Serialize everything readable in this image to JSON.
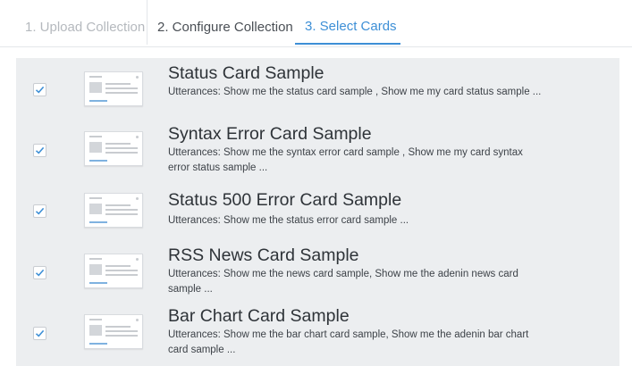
{
  "tabs": [
    {
      "label": "1. Upload Collection"
    },
    {
      "label": "2. Configure Collection"
    },
    {
      "label": "3. Select Cards"
    }
  ],
  "cards": [
    {
      "title": "Status Card Sample",
      "utterances": "Utterances:  Show me the status card sample ,  Show me my card status sample ...",
      "checked": true
    },
    {
      "title": "Syntax Error Card Sample",
      "utterances": "Utterances:  Show me the syntax error card sample ,  Show me my card syntax error status sample  ...",
      "checked": true
    },
    {
      "title": "Status 500 Error Card Sample",
      "utterances": "Utterances:  Show me the status error card sample  ...",
      "checked": true
    },
    {
      "title": "RSS News Card Sample",
      "utterances": "Utterances:  Show me the news card sample,  Show me the adenin news card sample  ...",
      "checked": true
    },
    {
      "title": "Bar Chart Card Sample",
      "utterances": "Utterances:  Show me the bar chart card sample,  Show me the adenin bar chart card sample  ...",
      "checked": true
    }
  ],
  "icons": {
    "checkbox": "checkmark-icon",
    "thumbnail": "card-preview-icon"
  },
  "colors": {
    "accent": "#3d8fd6",
    "panel": "#eceef0"
  }
}
